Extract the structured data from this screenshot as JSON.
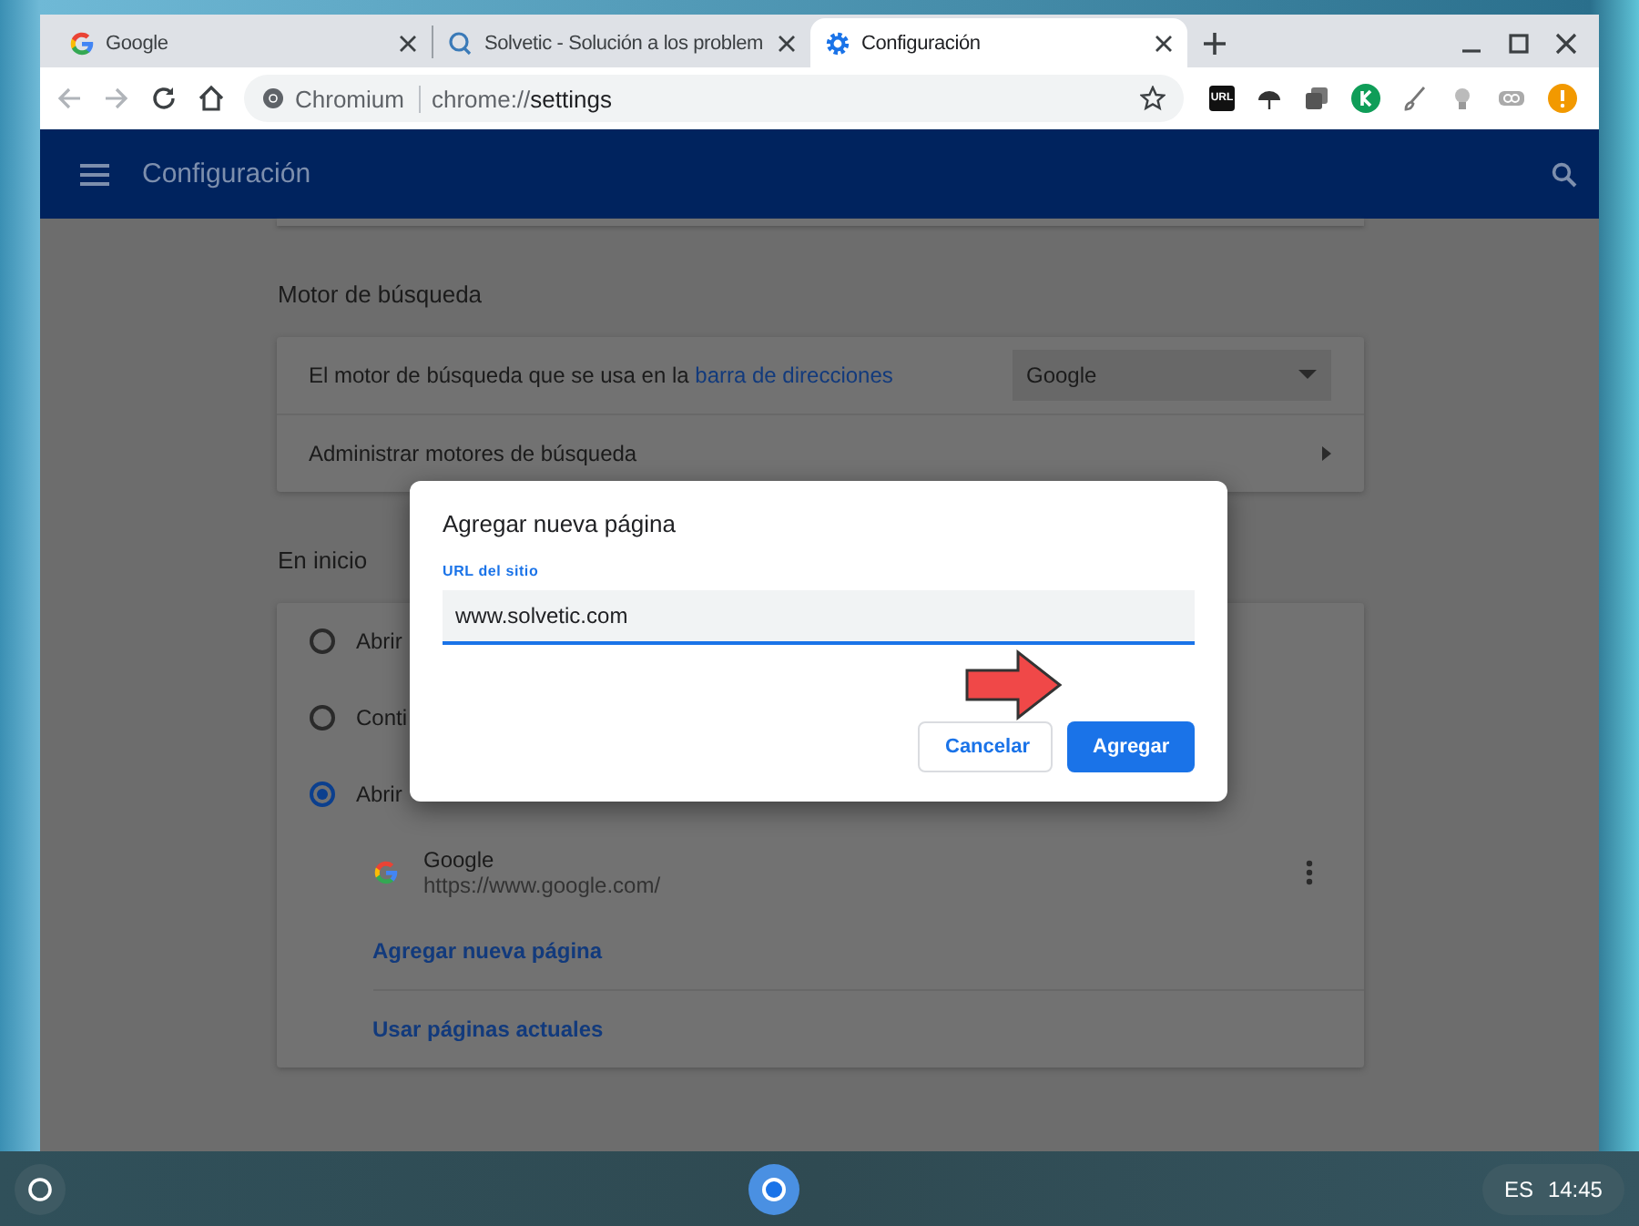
{
  "tabs": [
    {
      "title": "Google",
      "selected": false
    },
    {
      "title": "Solvetic - Solución a los problem",
      "selected": false
    },
    {
      "title": "Configuración",
      "selected": true
    }
  ],
  "omnibox": {
    "site_label": "Chromium",
    "url_prefix": "chrome://",
    "url_path": "settings"
  },
  "extensions": {
    "url_badge": "URL"
  },
  "header": {
    "title": "Configuración"
  },
  "search_engine": {
    "title": "Motor de búsqueda",
    "engine_text": "El motor de búsqueda que se usa en la ",
    "engine_link": "barra de direcciones",
    "engine_value": "Google",
    "manage_label": "Administrar motores de búsqueda"
  },
  "startup": {
    "title": "En inicio",
    "options": [
      {
        "label": "Abrir",
        "selected": false
      },
      {
        "label": "Conti",
        "selected": false
      },
      {
        "label": "Abrir",
        "selected": true
      }
    ],
    "pages": [
      {
        "name": "Google",
        "url": "https://www.google.com/"
      }
    ],
    "links": [
      "Agregar nueva página",
      "Usar páginas actuales"
    ]
  },
  "dialog": {
    "title": "Agregar nueva página",
    "field_label": "URL del sitio",
    "field_value": "www.solvetic.com",
    "buttons": [
      {
        "label": "Cancelar",
        "kind": "secondary"
      },
      {
        "label": "Agregar",
        "kind": "primary"
      }
    ]
  },
  "taskbar": {
    "language": "ES",
    "time": "14:45"
  }
}
